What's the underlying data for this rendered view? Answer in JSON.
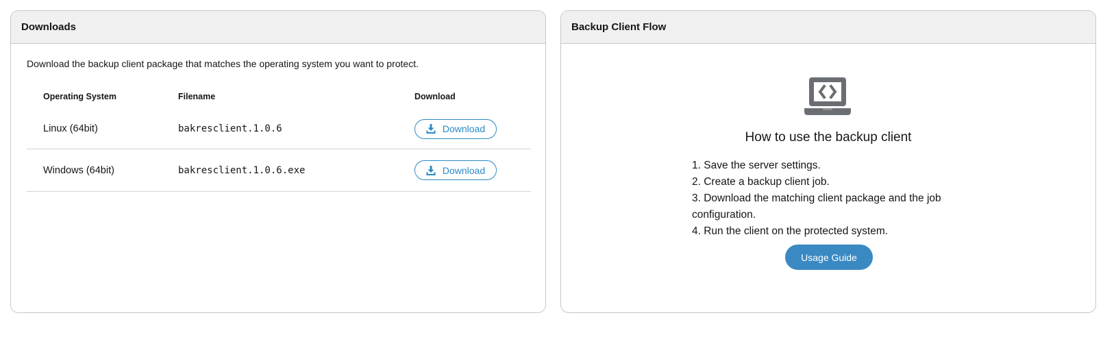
{
  "downloads": {
    "title": "Downloads",
    "description": "Download the backup client package that matches the operating system you want to protect.",
    "columns": {
      "os": "Operating System",
      "filename": "Filename",
      "download": "Download"
    },
    "rows": [
      {
        "os": "Linux (64bit)",
        "filename": "bakresclient.1.0.6",
        "button": "Download"
      },
      {
        "os": "Windows (64bit)",
        "filename": "bakresclient.1.0.6.exe",
        "button": "Download"
      }
    ]
  },
  "flow": {
    "title": "Backup Client Flow",
    "icon": "laptop-code-icon",
    "heading": "How to use the backup client",
    "steps": [
      "1. Save the server settings.",
      "2. Create a backup client job.",
      "3. Download the matching client package and the job configuration.",
      "4. Run the client on the protected system."
    ],
    "button": "Usage Guide"
  },
  "colors": {
    "accent": "#3a89c3",
    "header_bg": "#f0f0f0",
    "border": "#c7c7c7"
  }
}
